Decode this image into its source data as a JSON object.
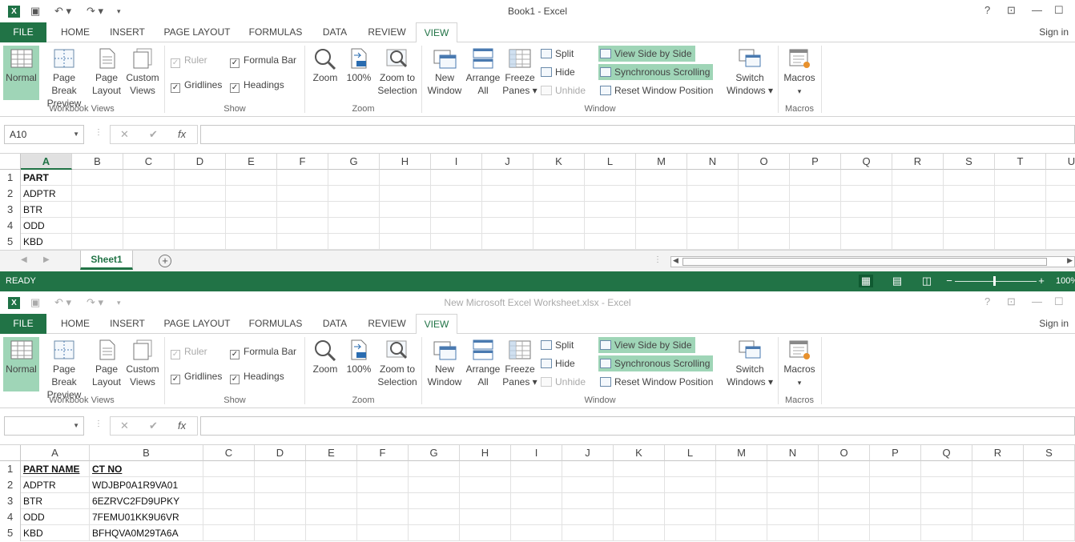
{
  "windows": [
    {
      "title": "Book1 - Excel",
      "name_box": "A10",
      "sheet_tab": "Sheet1",
      "status": "READY",
      "zoom": "100%",
      "columns": [
        "A",
        "B",
        "C",
        "D",
        "E",
        "F",
        "G",
        "H",
        "I",
        "J",
        "K",
        "L",
        "M",
        "N",
        "O",
        "P",
        "Q",
        "R",
        "S",
        "T",
        "U"
      ],
      "rows": [
        "1",
        "2",
        "3",
        "4",
        "5"
      ],
      "cells": {
        "A": [
          "PART",
          "ADPTR",
          "BTR",
          "ODD",
          "KBD"
        ],
        "B": [
          "",
          "",
          "",
          "",
          ""
        ]
      }
    },
    {
      "title": "New Microsoft Excel Worksheet.xlsx - Excel",
      "name_box": "",
      "columns": [
        "A",
        "B",
        "C",
        "D",
        "E",
        "F",
        "G",
        "H",
        "I",
        "J",
        "K",
        "L",
        "M",
        "N",
        "O",
        "P",
        "Q",
        "R",
        "S"
      ],
      "rows": [
        "1",
        "2",
        "3",
        "4",
        "5"
      ],
      "cells": {
        "A": [
          "PART NAME",
          "ADPTR",
          "BTR",
          "ODD",
          "KBD"
        ],
        "B": [
          "CT NO",
          "WDJBP0A1R9VA01",
          "6EZRVC2FD9UPKY",
          "7FEMU01KK9U6VR",
          "BFHQVA0M29TA6A"
        ]
      }
    }
  ],
  "tabs": [
    "FILE",
    "HOME",
    "INSERT",
    "PAGE LAYOUT",
    "FORMULAS",
    "DATA",
    "REVIEW",
    "VIEW"
  ],
  "sign_in": "Sign in",
  "ribbon": {
    "workbook_views": {
      "label": "Workbook Views",
      "normal": "Normal",
      "page_break_1": "Page Break",
      "page_break_2": "Preview",
      "page_layout_1": "Page",
      "page_layout_2": "Layout",
      "custom_1": "Custom",
      "custom_2": "Views"
    },
    "show": {
      "label": "Show",
      "ruler": "Ruler",
      "formula_bar": "Formula Bar",
      "gridlines": "Gridlines",
      "headings": "Headings"
    },
    "zoom": {
      "label": "Zoom",
      "zoom": "Zoom",
      "hundred": "100%",
      "zoom_sel_1": "Zoom to",
      "zoom_sel_2": "Selection"
    },
    "window": {
      "label": "Window",
      "new_1": "New",
      "new_2": "Window",
      "arrange_1": "Arrange",
      "arrange_2": "All",
      "freeze_1": "Freeze",
      "freeze_2": "Panes ▾",
      "split": "Split",
      "hide": "Hide",
      "unhide": "Unhide",
      "side_by_side": "View Side by Side",
      "sync_scroll": "Synchronous Scrolling",
      "reset_pos": "Reset Window Position",
      "switch_1": "Switch",
      "switch_2": "Windows ▾"
    },
    "macros": {
      "label": "Macros",
      "macros": "Macros",
      "arrow": "▾"
    }
  },
  "icons": {
    "check": "✓",
    "fx": "fx",
    "cancel": "✕",
    "enter": "✔"
  }
}
